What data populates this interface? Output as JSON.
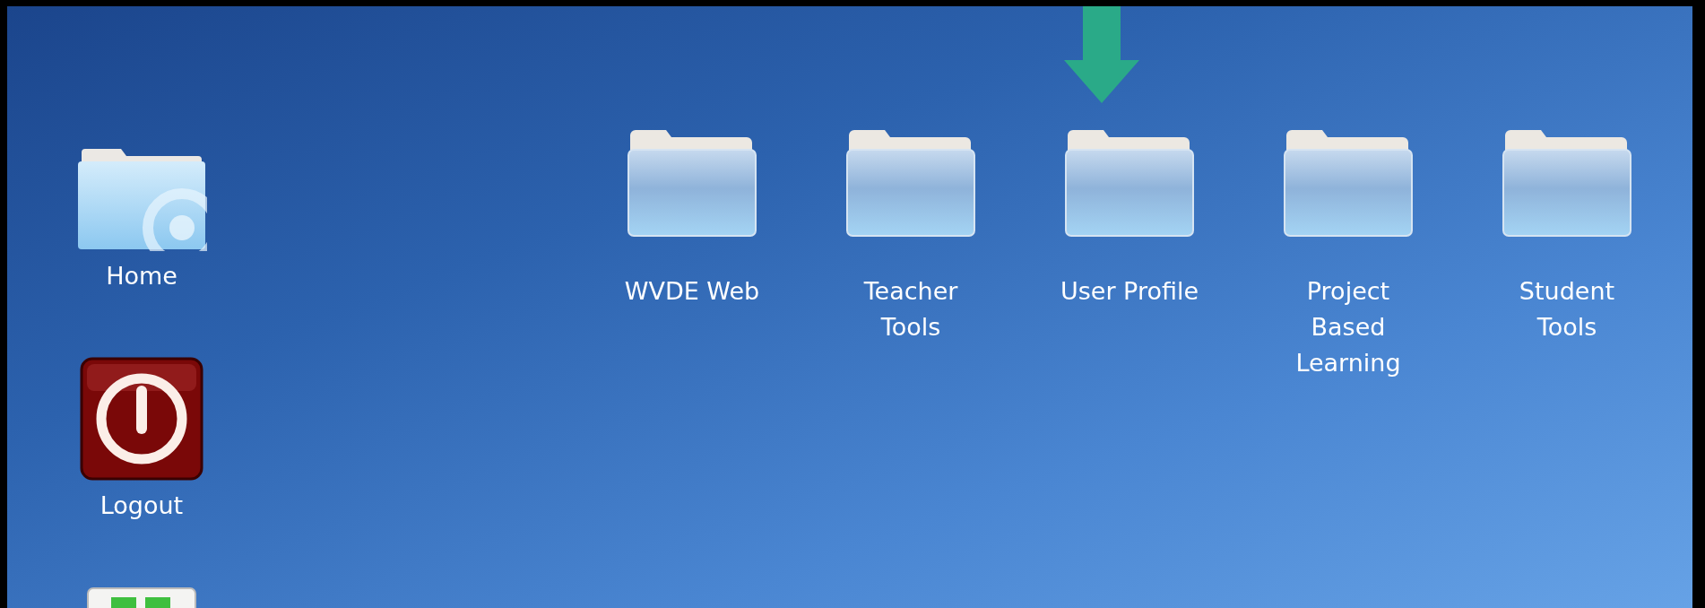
{
  "side_icons": [
    {
      "kind": "home",
      "label": "Home"
    },
    {
      "kind": "power",
      "label": "Logout"
    },
    {
      "kind": "grid"
    }
  ],
  "folders": [
    {
      "label": "WVDE Web"
    },
    {
      "label": "Teacher\nTools"
    },
    {
      "label": "User Profile",
      "pointed": true
    },
    {
      "label": "Project\nBased\nLearning"
    },
    {
      "label": "Student\nTools"
    }
  ]
}
